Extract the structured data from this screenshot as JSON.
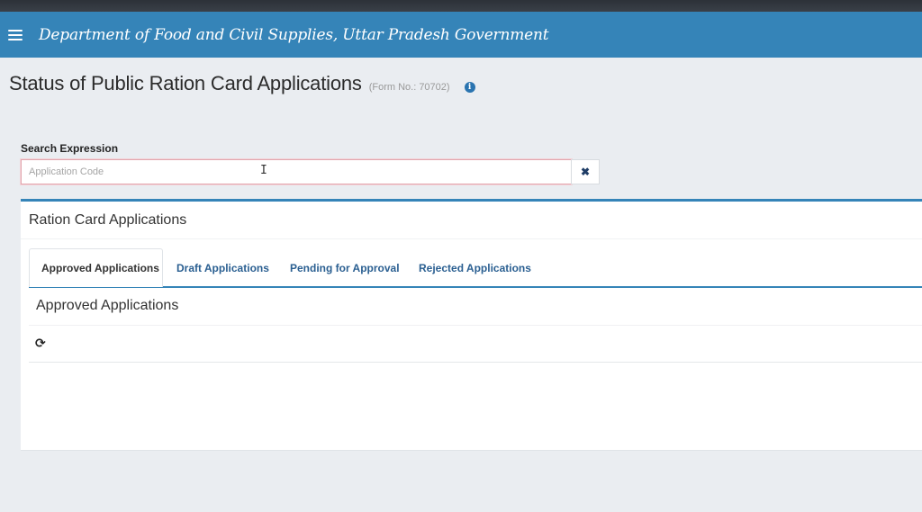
{
  "header": {
    "app_title": "Department of Food and Civil Supplies, Uttar Pradesh Government",
    "menu_icon": "hamburger-menu-icon",
    "bar_color": "#3584b8"
  },
  "page": {
    "title": "Status of Public Ration Card Applications",
    "form_no": "(Form No.: 70702)",
    "info_icon": "info-circle-icon"
  },
  "search": {
    "label": "Search Expression",
    "placeholder": "Application Code",
    "value": "",
    "clear_icon": "close-icon"
  },
  "panel": {
    "title": "Ration Card Applications",
    "tabs": [
      {
        "label": "Approved Applications",
        "active": true
      },
      {
        "label": "Draft Applications",
        "active": false
      },
      {
        "label": "Pending for Approval",
        "active": false
      },
      {
        "label": "Rejected Applications",
        "active": false
      }
    ],
    "active_tab_title": "Approved Applications",
    "refresh_icon": "refresh-icon"
  }
}
